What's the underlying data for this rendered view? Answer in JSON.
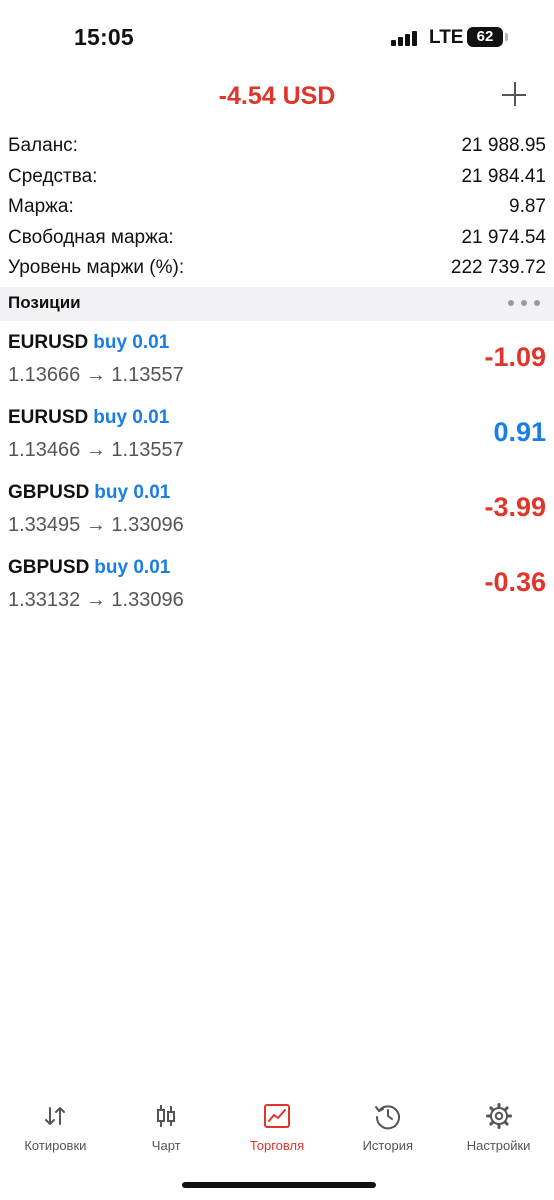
{
  "status_bar": {
    "time": "15:05",
    "network": "LTE",
    "battery": "62"
  },
  "header": {
    "total_profit": "-4.54 USD",
    "add_icon": "plus-icon"
  },
  "summary": [
    {
      "label": "Баланс:",
      "value": "21 988.95"
    },
    {
      "label": "Средства:",
      "value": "21 984.41"
    },
    {
      "label": "Маржа:",
      "value": "9.87"
    },
    {
      "label": "Свободная маржа:",
      "value": "21 974.54"
    },
    {
      "label": "Уровень маржи (%):",
      "value": "222 739.72"
    }
  ],
  "positions": {
    "title": "Позиции",
    "more_icon": "ellipsis-icon",
    "items": [
      {
        "symbol": "EURUSD",
        "side": "buy 0.01",
        "prices": "1.13666 → 1.13557",
        "profit": "-1.09"
      },
      {
        "symbol": "EURUSD",
        "side": "buy 0.01",
        "prices": "1.13466 → 1.13557",
        "profit": "0.91"
      },
      {
        "symbol": "GBPUSD",
        "side": "buy 0.01",
        "prices": "1.33495 → 1.33096",
        "profit": "-3.99"
      },
      {
        "symbol": "GBPUSD",
        "side": "buy 0.01",
        "prices": "1.33132 → 1.33096",
        "profit": "-0.36"
      }
    ]
  },
  "tabs": [
    {
      "label": "Котировки",
      "icon": "quotes-arrows-icon"
    },
    {
      "label": "Чарт",
      "icon": "candlestick-chart-icon"
    },
    {
      "label": "Торговля",
      "icon": "trade-chart-icon",
      "active": true
    },
    {
      "label": "История",
      "icon": "history-clock-icon"
    },
    {
      "label": "Настройки",
      "icon": "gear-icon"
    }
  ],
  "colors": {
    "loss": "#e0352b",
    "gain": "#1a7ee6",
    "active_tab": "#e0352b",
    "inactive_tab": "#555555",
    "section_bg": "#f2f2f4"
  }
}
